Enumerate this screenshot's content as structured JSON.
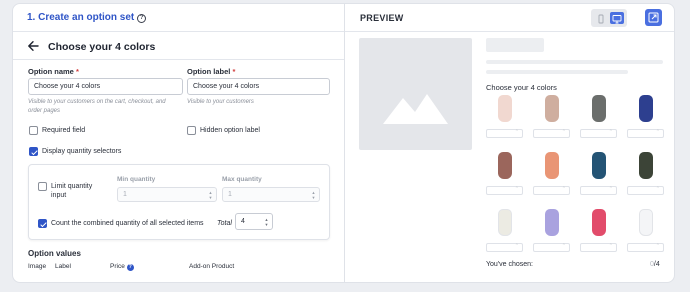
{
  "left_panel": {
    "step_title": "1. Create an option set",
    "help_icon_glyph": "?",
    "subheader_title": "Choose your 4 colors",
    "option_name": {
      "label": "Option name",
      "required_mark": "*",
      "value": "Choose your 4 colors",
      "hint": "Visible to your customers on the cart, checkout, and order pages"
    },
    "option_label": {
      "label": "Option label",
      "required_mark": "*",
      "value": "Choose your 4 colors",
      "hint": "Visible to your customers"
    },
    "checkboxes": {
      "required_field": {
        "label": "Required field",
        "checked": false
      },
      "hidden_option_label": {
        "label": "Hidden option label",
        "checked": false
      },
      "display_quantity_selectors": {
        "label": "Display quantity selectors",
        "checked": true
      }
    },
    "quantity": {
      "limit_label_line1": "Limit quantity",
      "limit_label_line2": "input",
      "limit_checked": false,
      "min_label": "Min quantity",
      "min_value": "1",
      "max_label": "Max quantity",
      "max_value": "1",
      "count_combined_label": "Count the combined quantity of all selected items",
      "count_combined_checked": true,
      "total_label": "Total",
      "total_value": "4"
    },
    "option_values": {
      "title": "Option values",
      "columns": [
        "Image",
        "Label",
        "Price",
        "Add-on Product"
      ],
      "price_info_glyph": "?"
    }
  },
  "right_panel": {
    "preview_title": "PREVIEW",
    "choose_label": "Choose your 4 colors",
    "swatches": [
      {
        "color": "#f1d8d0"
      },
      {
        "color": "#cfae9f"
      },
      {
        "color": "#6b6e6c"
      },
      {
        "color": "#2d3f8f"
      },
      {
        "color": "#9b665c"
      },
      {
        "color": "#e99575"
      },
      {
        "color": "#245475"
      },
      {
        "color": "#3c4437"
      },
      {
        "color": "#ecebe3"
      },
      {
        "color": "#a9a2df"
      },
      {
        "color": "#e24c6b"
      },
      {
        "color": "#f4f5f7"
      }
    ],
    "chosen_label": "You've chosen:",
    "chosen_current": "0",
    "chosen_total": "/4"
  },
  "colors": {
    "accent": "#2f55c7",
    "button_blue": "#4a6fe0",
    "required": "#d13b3b"
  }
}
